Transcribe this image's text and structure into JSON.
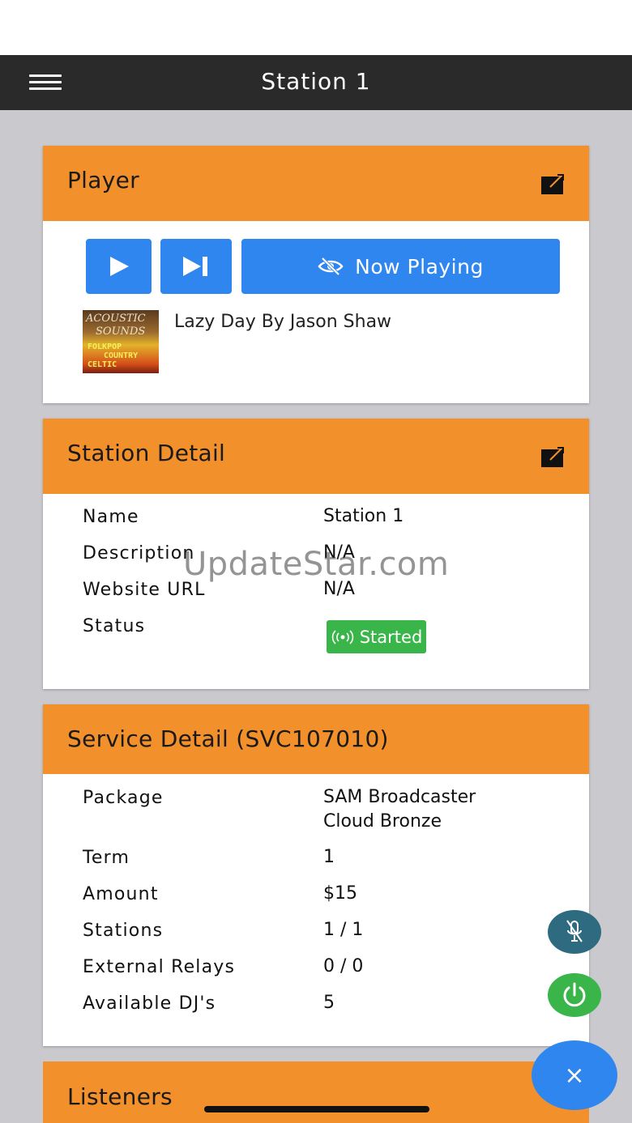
{
  "header": {
    "title": "Station 1"
  },
  "player": {
    "title": "Player",
    "now_playing_label": "Now Playing",
    "track": "Lazy Day By Jason Shaw",
    "album_art_text": {
      "line1": "ACOUSTIC",
      "line2": "SOUNDS",
      "line3": "FOLKPOP",
      "line4": "COUNTRY",
      "line5": "CELTIC"
    }
  },
  "station_detail": {
    "title": "Station Detail",
    "rows": [
      {
        "label": "Name",
        "value": "Station 1"
      },
      {
        "label": "Description",
        "value": "N/A"
      },
      {
        "label": "Website URL",
        "value": "N/A"
      },
      {
        "label": "Status",
        "value": "Started"
      }
    ]
  },
  "service_detail": {
    "title": "Service Detail (SVC107010)",
    "rows": [
      {
        "label": "Package",
        "value_line1": "SAM Broadcaster",
        "value_line2": "Cloud Bronze"
      },
      {
        "label": "Term",
        "value": "1"
      },
      {
        "label": "Amount",
        "value": "$15"
      },
      {
        "label": "Stations",
        "value": "1 / 1"
      },
      {
        "label": "External Relays",
        "value": "0 / 0"
      },
      {
        "label": "Available DJ's",
        "value": "5"
      }
    ]
  },
  "listeners": {
    "title": "Listeners"
  },
  "watermark": "UpdateStar.com",
  "fab": {
    "close_symbol": "×"
  },
  "colors": {
    "accent": "#f2902b",
    "button": "#2f86ef",
    "success": "#3ab54a",
    "mic": "#2e6b80",
    "navbar": "#2a2a2a"
  }
}
